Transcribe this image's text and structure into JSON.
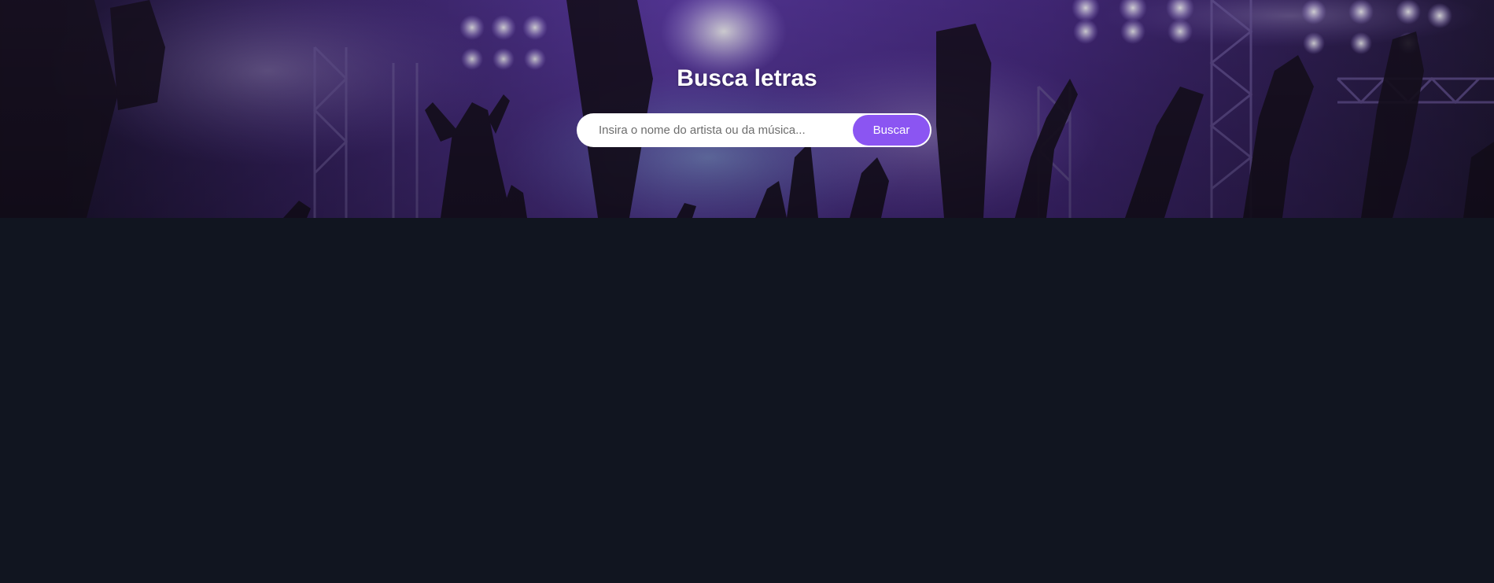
{
  "colors": {
    "page_background": "#111520",
    "accent": "#8b55f2",
    "hero_tint": "#5b3aa8"
  },
  "header": {
    "title": "Busca letras",
    "background_image": "concert-crowd-stage-lights"
  },
  "search": {
    "placeholder": "Insira o nome do artista ou da música...",
    "value": "",
    "button_label": "Buscar"
  }
}
